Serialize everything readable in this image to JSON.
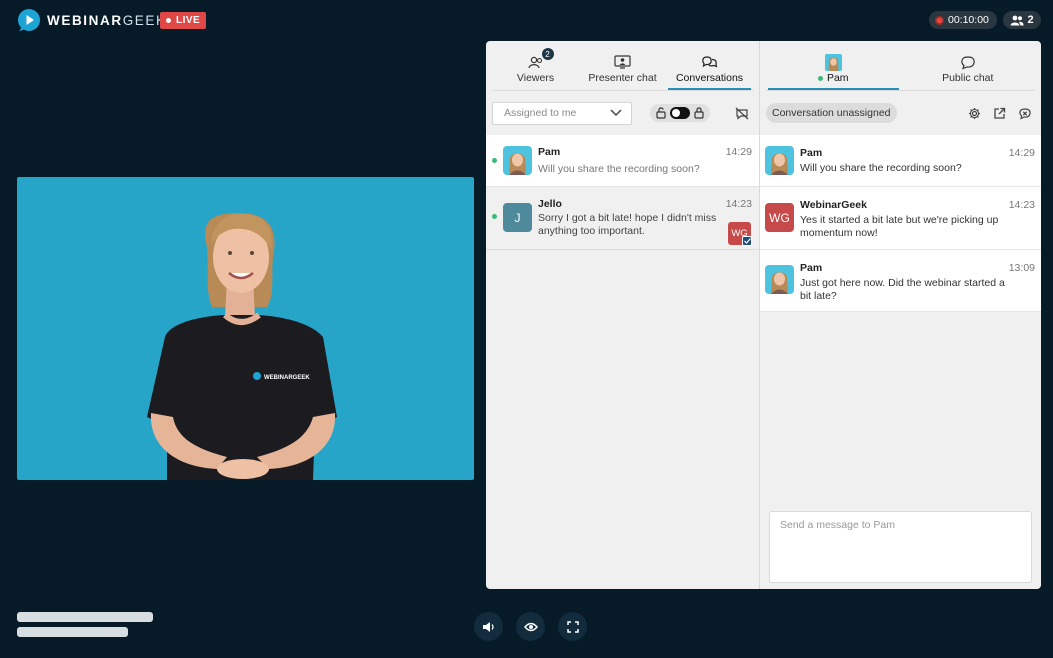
{
  "brand": {
    "name_bold": "WEBINAR",
    "name_light": "GEEK",
    "live_label": "LIVE"
  },
  "header": {
    "timer": "00:10:00",
    "viewer_count": "2"
  },
  "video": {
    "shirt_logo": "WEBINARGEEK"
  },
  "panel": {
    "left_tabs": [
      {
        "label": "Viewers",
        "badge": "2"
      },
      {
        "label": "Presenter chat"
      },
      {
        "label": "Conversations"
      }
    ],
    "filter": {
      "selected": "Assigned to me"
    },
    "conversations": [
      {
        "name": "Pam",
        "time": "14:29",
        "text": "Will you share the recording soon?"
      },
      {
        "name": "Jello",
        "initial": "J",
        "time": "14:23",
        "text": "Sorry I got a bit late! hope I didn't miss anything too important.",
        "assignee": "WG"
      }
    ],
    "right_tabs": [
      {
        "label": "Pam"
      },
      {
        "label": "Public chat"
      }
    ],
    "status": "Conversation unassigned",
    "messages": [
      {
        "name": "Pam",
        "time": "14:29",
        "text": "Will you share the recording soon?"
      },
      {
        "name": "WebinarGeek",
        "initial": "WG",
        "time": "14:23",
        "text": "Yes it started a bit late but we're picking up momentum now!"
      },
      {
        "name": "Pam",
        "time": "13:09",
        "text": "Just got here now. Did the webinar started a bit late?"
      }
    ],
    "compose_placeholder": "Send a message to Pam"
  },
  "colors": {
    "background": "#061a27",
    "video_bg": "#27a5c8",
    "live": "#e04848",
    "accent": "#2b8fb5",
    "online": "#3cb878",
    "wg_avatar": "#c64a4a"
  },
  "icons": [
    "logo-play",
    "viewers",
    "presenter-screen",
    "conversations-bubbles",
    "chevron-down",
    "lock-open",
    "lock",
    "chat-off",
    "settings-gear",
    "external-link",
    "chat-close",
    "volume",
    "eye",
    "fullscreen",
    "record-dot",
    "people"
  ]
}
